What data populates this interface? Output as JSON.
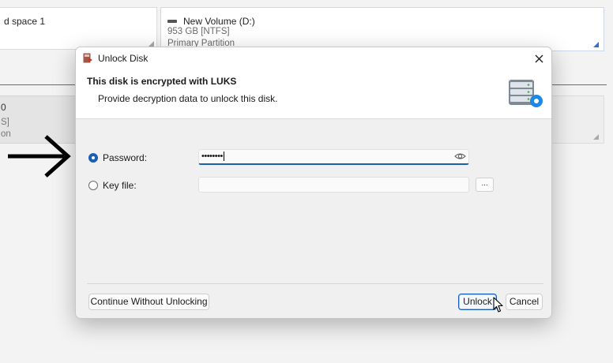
{
  "background": {
    "partition_left": {
      "name": "d space 1"
    },
    "volume": {
      "name": "New Volume (D:)",
      "size": "953 GB [NTFS]",
      "type": "Primary Partition"
    },
    "partition_left2": {
      "line1": "0",
      "line2": "S]",
      "line3": "on"
    }
  },
  "dialog": {
    "title": "Unlock Disk",
    "close_glyph": "✕",
    "header_title": "This disk is encrypted with LUKS",
    "header_subtitle": "Provide decryption data to unlock this disk.",
    "password_label": "Password:",
    "password_value": "••••••••",
    "keyfile_label": "Key file:",
    "keyfile_value": "",
    "browse_label": "...",
    "continue_label": "Continue Without Unlocking",
    "unlock_label": "Unlock",
    "cancel_label": "Cancel"
  },
  "colors": {
    "accent": "#1a5fb4",
    "selection_outline": "#2f6fd0"
  },
  "icons": [
    "app-icon",
    "close-icon",
    "server-key-icon",
    "eye-icon",
    "arrow-icon",
    "mouse-cursor-icon",
    "drive-icon"
  ]
}
